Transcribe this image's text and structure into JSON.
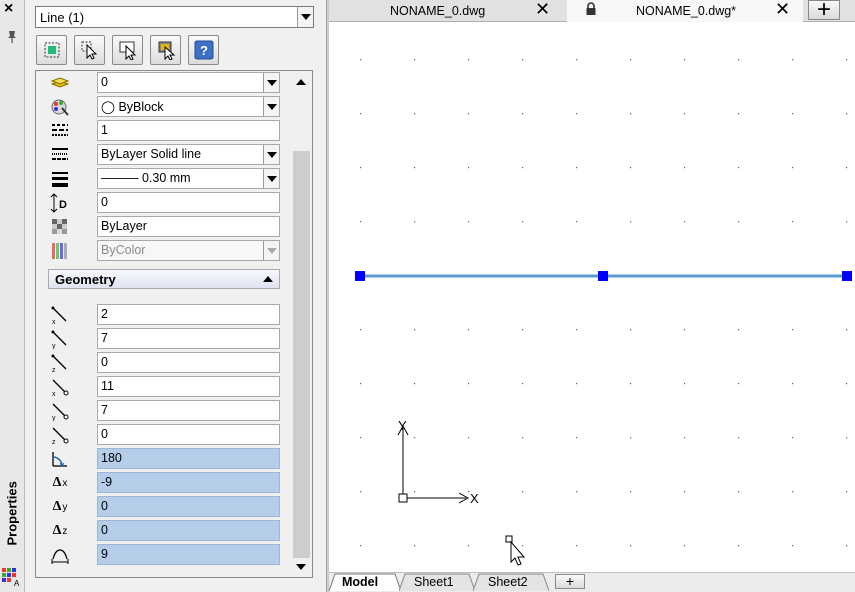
{
  "panel": {
    "close_glyph": "×",
    "side_label": "Properties",
    "selector_value": "Line (1)",
    "toolbar": {
      "help_label": "?"
    },
    "general": [
      {
        "icon": "layer-icon",
        "value": "0",
        "dropdown": true
      },
      {
        "icon": "color-icon",
        "value": "◯  ByBlock",
        "dropdown": true
      },
      {
        "icon": "linetype-scale-icon",
        "value": "1",
        "dropdown": false
      },
      {
        "icon": "linetype-icon",
        "value": "ByLayer     Solid line",
        "dropdown": true
      },
      {
        "icon": "lineweight-icon",
        "value": "——— 0.30 mm",
        "dropdown": true
      },
      {
        "icon": "thickness-icon",
        "value": "0",
        "dropdown": false
      },
      {
        "icon": "transparency-icon",
        "value": "ByLayer",
        "dropdown": false
      },
      {
        "icon": "plot-style-icon",
        "value": "ByColor",
        "dropdown": true,
        "disabled": true
      }
    ],
    "geometry_header": "Geometry",
    "geometry": [
      {
        "icon": "start-x-icon",
        "value": "2"
      },
      {
        "icon": "start-y-icon",
        "value": "7"
      },
      {
        "icon": "start-z-icon",
        "value": "0"
      },
      {
        "icon": "end-x-icon",
        "value": "11"
      },
      {
        "icon": "end-y-icon",
        "value": "7"
      },
      {
        "icon": "end-z-icon",
        "value": "0"
      },
      {
        "icon": "angle-icon",
        "value": "180",
        "readonly": true
      },
      {
        "icon": "delta-x-icon",
        "value": "-9",
        "readonly": true
      },
      {
        "icon": "delta-y-icon",
        "value": "0",
        "readonly": true
      },
      {
        "icon": "delta-z-icon",
        "value": "0",
        "readonly": true
      },
      {
        "icon": "length-icon",
        "value": "9",
        "readonly": true
      }
    ],
    "delta_labels": {
      "x": "Δx",
      "y": "Δy",
      "z": "Δz"
    }
  },
  "doc_tabs": [
    {
      "label": "NONAME_0.dwg",
      "active": false,
      "close": "✕"
    },
    {
      "label": "NONAME_0.dwg*",
      "active": true,
      "close": "✕"
    }
  ],
  "new_tab_label": "+",
  "layout_tabs": [
    "Model",
    "Sheet1",
    "Sheet2"
  ],
  "add_sheet_label": "+",
  "ucs": {
    "x_label": "X",
    "y_label": "Y"
  },
  "colors": {
    "line": "#5b9bd5",
    "grip": "#0000ff",
    "selected_field": "#b5cde9"
  }
}
